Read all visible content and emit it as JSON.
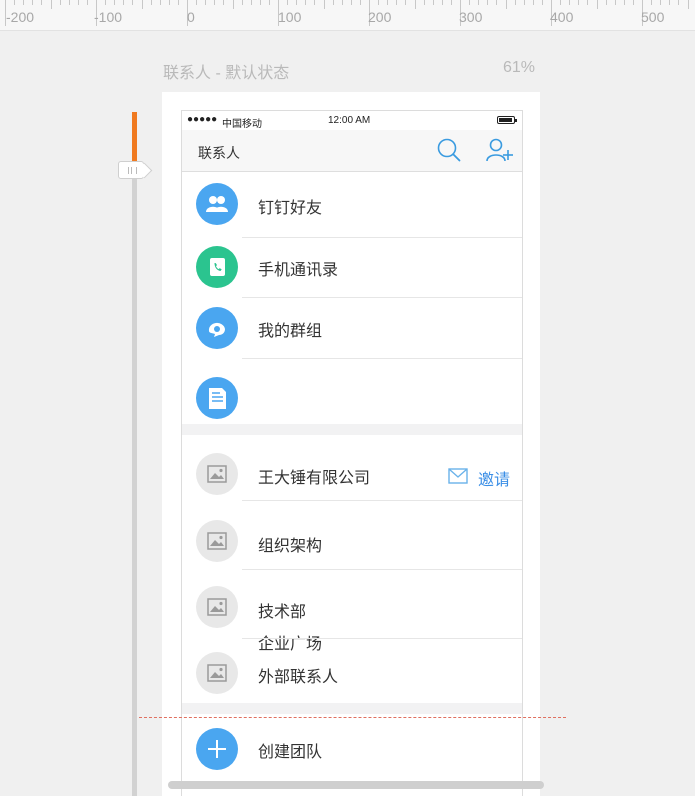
{
  "ruler": {
    "labels": [
      "-200",
      "-100",
      "0",
      "100",
      "200",
      "300",
      "400",
      "500"
    ]
  },
  "canvas": {
    "artboard_title": "联系人 - 默认状态",
    "zoom_level": "61%"
  },
  "phone": {
    "status_bar": {
      "signal": "●●●●●",
      "carrier": "中国移动",
      "time": "12:00 AM"
    },
    "nav": {
      "title": "联系人",
      "search_icon": "search-icon",
      "add_contact_icon": "add-user-icon"
    },
    "top_items": [
      {
        "label": "钉钉好友",
        "icon": "friends-icon",
        "color": "#4aa6f0"
      },
      {
        "label": "手机通讯录",
        "icon": "phonebook-icon",
        "color": "#2bc48f"
      },
      {
        "label": "我的群组",
        "icon": "group-icon",
        "color": "#4aa6f0"
      },
      {
        "label": "企业广场",
        "icon": "document-icon",
        "color": "#4aa6f0"
      }
    ],
    "org_items": [
      {
        "label": "王大锤有限公司",
        "icon": "image-placeholder-icon"
      },
      {
        "label": "组织架构",
        "icon": "image-placeholder-icon"
      },
      {
        "label": "技术部",
        "icon": "image-placeholder-icon"
      },
      {
        "label": "外部联系人",
        "icon": "image-placeholder-icon"
      }
    ],
    "invite": {
      "label": "邀请",
      "icon": "mail-icon",
      "color": "#3a8ee6"
    },
    "create_team": {
      "label": "创建团队",
      "icon": "plus-icon",
      "color": "#4aa6f0"
    }
  },
  "colors": {
    "slider_active": "#f07a20",
    "accent": "#3a8ee6",
    "placeholder_bg": "#e8e8e8"
  }
}
